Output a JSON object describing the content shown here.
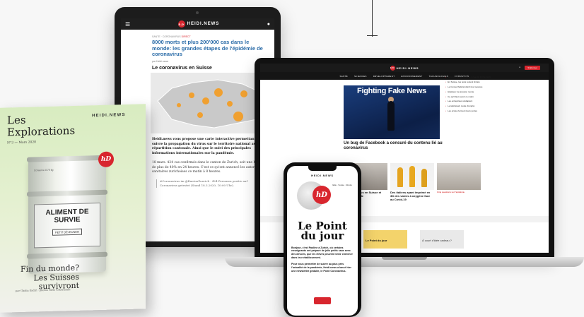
{
  "tablet": {
    "brand": "HEIDI.NEWS",
    "logo": "hD",
    "meta_section": "SANTE · CORONAVIRUS",
    "meta_tag": "DIRECT",
    "title": "8000 morts et plus 200'000 cas dans le monde: les grandes étapes de l'épidémie de coronavirus",
    "author": "par Heidi.news",
    "subtitle": "Le coronavirus en Suisse",
    "paragraph1_bold": "Heidi.news vous propose une carte interactive permettant de suivre la propagation du virus sur le territoire national avec la répartition cantonale. Ainsi que le suivi des principales informations internationales sur la pandémie.",
    "paragraph2": "18 mars. 424 cas confirmés dans le canton de Zurich, soit une hausse de plus de 40% en 24 heures. C'est ce qu'ont annoncé les autorités sanitaires zurichoises ce matin à 8 heures.",
    "quote": "#Coronavirus im @KantonZuerich · 424 Personen positiv auf Coronavirus getestet (Stand 18.3.2020, 10:00 Uhr)."
  },
  "laptop": {
    "brand": "HEIDI.NEWS",
    "subscribe": "S'abonner",
    "nav": [
      "SANTÉ",
      "SCIENCES",
      "DÉVELOPPEMENT",
      "ENVIRONNEMENT",
      "TECHNOLOGIES",
      "FORMATION"
    ],
    "hero_text": "Fighting Fake News",
    "headline": "Un bug de Facebook a censuré du contenu lié au coronavirus",
    "side_items": [
      "Coronavirus: les experts romands font le point",
      "En Suisse, les tests restent limités",
      "Le Conseil fédéral durcit les mesures",
      "Hôpitaux: la pression monte",
      "Ce qu'il faut savoir ce matin",
      "Les entreprises s'adaptent",
      "Le télétravail, mode d'emploi",
      "Les écoles ferment leurs portes"
    ],
    "captions": [
      "Le coronavirus en Suisse et dans le monde",
      "Des italiens ayant imprimé en 3D des valves à oxygène face au Covid-19",
      "Cinq questions sur l'épidémie"
    ],
    "promo": "Le Point du jour",
    "gift": "À court d'idée cadeau ?"
  },
  "magazine": {
    "title_line1": "Les",
    "title_line2": "Explorations",
    "brand": "HEIDI.NEWS",
    "issue": "N°3 — Mars 2020",
    "logo": "hD",
    "can_main": "ALIMENT DE SURVIE",
    "can_sub": "PETIT DÉJEUNER",
    "can_top": "Conserve 0.75 kg",
    "headline": "Fin du monde? Les Suisses survivront",
    "credits": "par Ghalia Kadiri · photos Niels Ackermann"
  },
  "phone": {
    "brand": "HEIDI.NEWS",
    "logo": "hD",
    "title_line1": "Le Point",
    "title_line2": "du jour",
    "separator": "",
    "side_text": "Italie · Suisse · Monde",
    "intro": "Bonjour, c'est Paoline à Zurich, où certains enseignants ont préparé de jolis petits saus avec des devoirs, que les élèves peuvent venir chercher dans leur établissement.",
    "body": "Pour vous permettre de suivre au plus près l'actualité de la pandémie, Heidi.news a lancé hier une newsletter gratuite, le Point Coronavirus."
  }
}
